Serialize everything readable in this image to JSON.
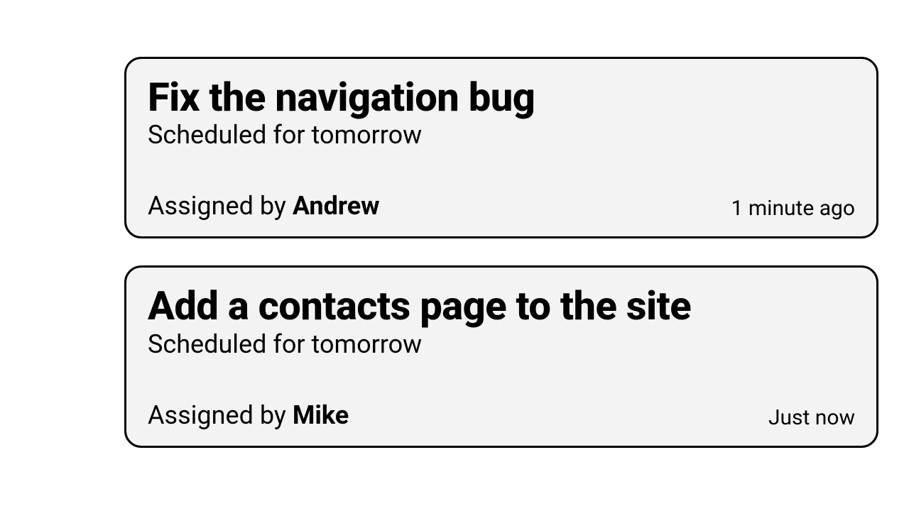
{
  "tasks": [
    {
      "title": "Fix the navigation bug",
      "schedule": "Scheduled for tomorrow",
      "assigned_prefix": "Assigned by ",
      "assigned_by": "Andrew",
      "timestamp": "1 minute ago"
    },
    {
      "title": "Add a contacts page to the site",
      "schedule": "Scheduled for tomorrow",
      "assigned_prefix": "Assigned by ",
      "assigned_by": "Mike",
      "timestamp": "Just now"
    }
  ]
}
